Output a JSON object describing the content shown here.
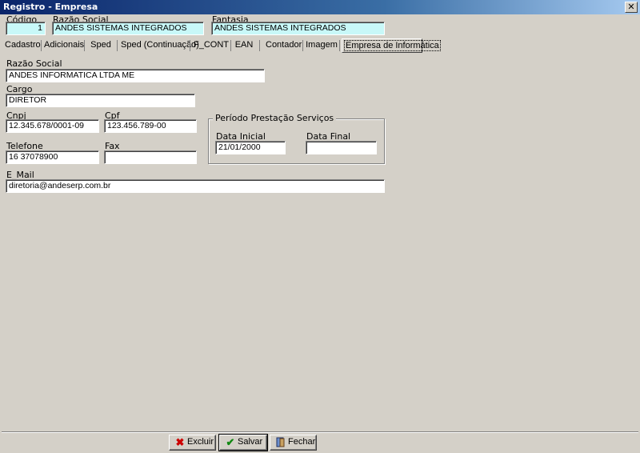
{
  "window": {
    "title": "Registro - Empresa",
    "close_glyph": "✕"
  },
  "header": {
    "codigo_label": "Código",
    "codigo_value": "1",
    "razao_label": "Razão Social",
    "razao_value": "ANDES SISTEMAS INTEGRADOS",
    "fantasia_label": "Fantasia",
    "fantasia_value": "ANDES SISTEMAS INTEGRADOS"
  },
  "tabs": [
    {
      "label": "Cadastro"
    },
    {
      "label": "Adicionais"
    },
    {
      "label": "Sped"
    },
    {
      "label": "Sped (Continuação)"
    },
    {
      "label": "F_CONT"
    },
    {
      "label": "EAN"
    },
    {
      "label": "Contador"
    },
    {
      "label": "Imagem"
    },
    {
      "label": "Empresa de Informática"
    }
  ],
  "form": {
    "razao_label": "Razão Social",
    "razao_value": "ANDES INFORMATICA LTDA ME",
    "cargo_label": "Cargo",
    "cargo_value": "DIRETOR",
    "cnpj_label": "Cnpj",
    "cnpj_value": "12.345.678/0001-09",
    "cpf_label": "Cpf",
    "cpf_value": "123.456.789-00",
    "telefone_label": "Telefone",
    "telefone_value": "16 37078900",
    "fax_label": "Fax",
    "fax_value": "",
    "email_label": "E_Mail",
    "email_value": "diretoria@andeserp.com.br",
    "periodo": {
      "title": "Período Prestação Serviços",
      "inicial_label": "Data Inicial",
      "inicial_value": "21/01/2000",
      "final_label": "Data Final",
      "final_value": ""
    }
  },
  "buttons": {
    "excluir": {
      "label": "Excluir",
      "icon": "x-icon"
    },
    "salvar": {
      "label": "Salvar",
      "icon": "check-icon"
    },
    "fechar": {
      "label": "Fechar",
      "icon": "door-icon"
    }
  },
  "colors": {
    "titlebar": "#0a246a",
    "highlight_field": "#c8f8f8",
    "excluir_icon": "#cc0000",
    "salvar_icon": "#118811"
  }
}
